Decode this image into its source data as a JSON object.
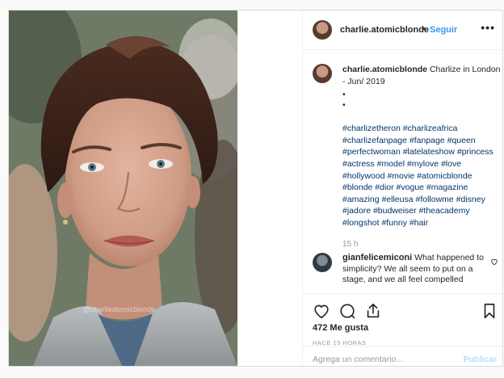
{
  "post": {
    "username": "charlie.atomicblonde",
    "separator": "•",
    "follow_label": "Seguir",
    "more_label": "•••",
    "photo_watermark": "@charlieatomicblonde"
  },
  "caption": {
    "username": "charlie.atomicblonde",
    "text": "Charlize in London - Jun/ 2019",
    "bullets": [
      "•",
      "•"
    ],
    "hashtags": "#charlizetheron #charlizeafrica #charlizefanpage #fanpage #queen #perfectwoman #latelateshow #princess #actress #model #mylove #love #hollywood #movie #atomicblonde #blonde #dior #vogue #magazine #amazing #elleusa #followme #disney #jadore #budweiser #theacademy #longshot #funny #hair",
    "time": "15 h"
  },
  "comment": {
    "username": "gianfelicemiconi",
    "text": "What happened to simplicity? We all seem to put on a stage, and we all feel compelled"
  },
  "actions": {
    "likes": "472 Me gusta",
    "time_ago": "HACE 15 HORAS",
    "comment_placeholder": "Agrega un comentario...",
    "publish_label": "Publicar"
  },
  "icons": [
    "heart-icon",
    "comment-icon",
    "share-icon",
    "bookmark-icon",
    "more-options-icon"
  ],
  "colors": {
    "link_blue": "#3897f0",
    "hashtag": "#003569",
    "muted": "#999999",
    "publish_disabled": "#b2dffc"
  }
}
